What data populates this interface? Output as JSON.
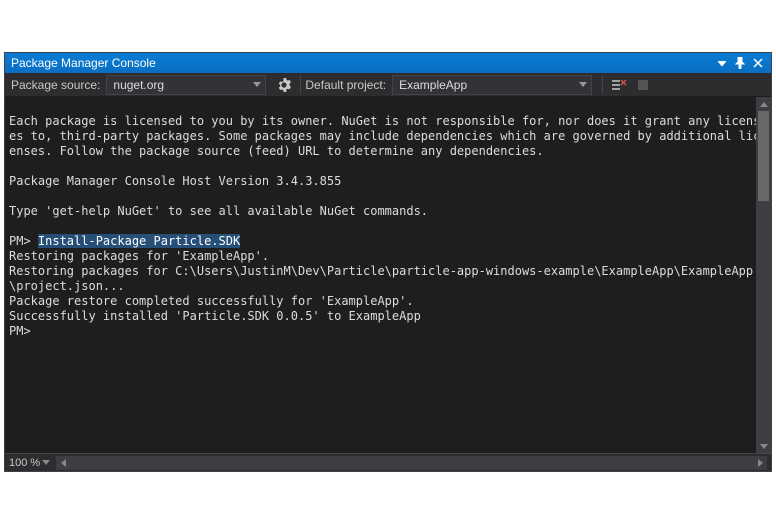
{
  "titlebar": {
    "title": "Package Manager Console"
  },
  "toolbar": {
    "package_source_label": "Package source:",
    "package_source_value": "nuget.org",
    "default_project_label": "Default project:",
    "default_project_value": "ExampleApp"
  },
  "console": {
    "preamble1": "Each package is licensed to you by its owner. NuGet is not responsible for, nor does it grant any licenses to, third-party packages. Some packages may include dependencies which are governed by additional licenses. Follow the package source (feed) URL to determine any dependencies.",
    "blank": "",
    "host": "Package Manager Console Host Version 3.4.3.855",
    "help": "Type 'get-help NuGet' to see all available NuGet commands.",
    "prompt1_prefix": "PM> ",
    "prompt1_cmd": "Install-Package Particle.SDK",
    "restore1": "Restoring packages for 'ExampleApp'.",
    "restore2": "Restoring packages for C:\\Users\\JustinM\\Dev\\Particle\\particle-app-windows-example\\ExampleApp\\ExampleApp\\project.json...",
    "restore3": "Package restore completed successfully for 'ExampleApp'.",
    "installed": "Successfully installed 'Particle.SDK 0.0.5' to ExampleApp",
    "prompt2": "PM> "
  },
  "statusbar": {
    "zoom": "100 %"
  }
}
